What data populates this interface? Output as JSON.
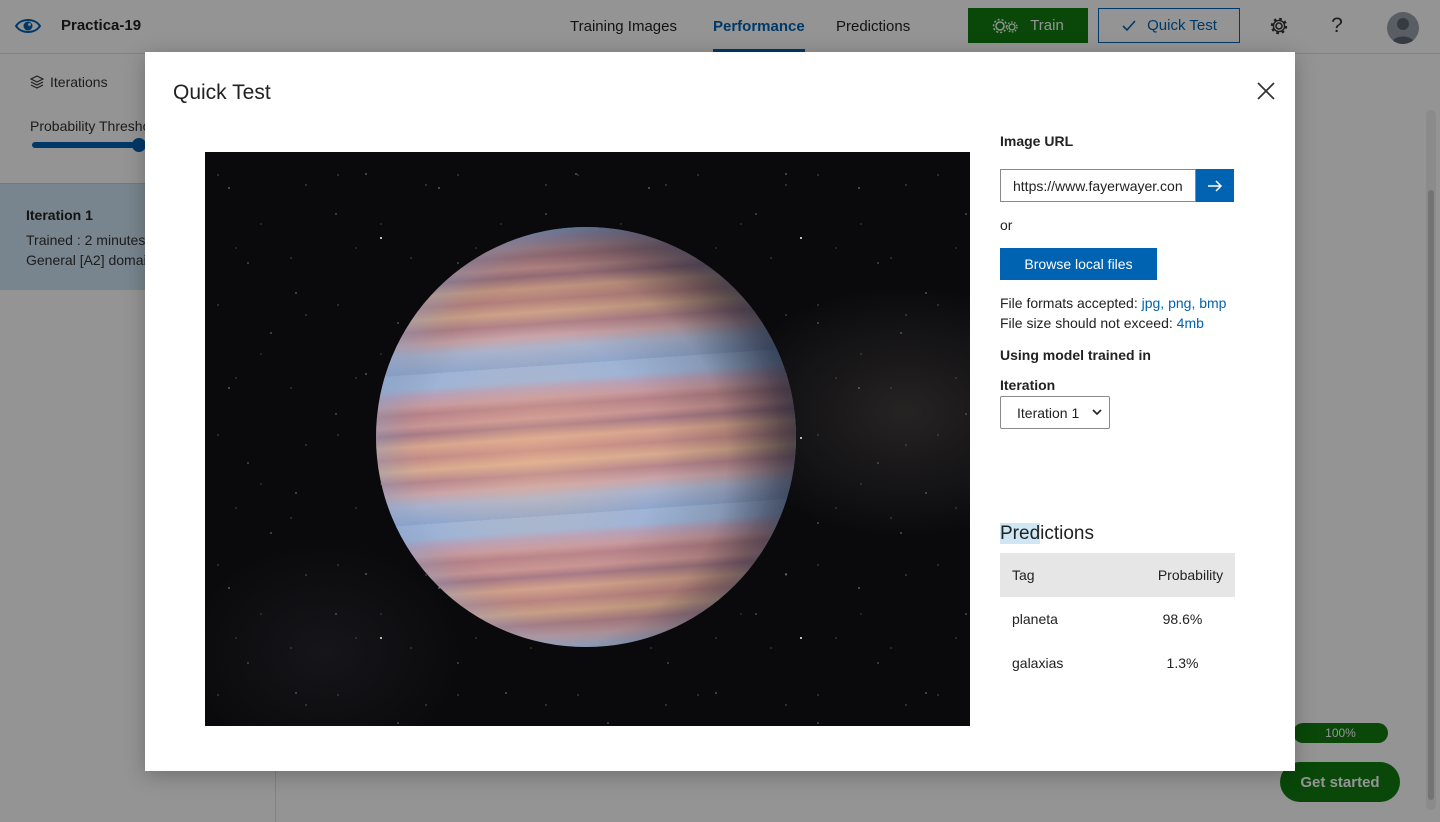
{
  "header": {
    "project_name": "Practica-19",
    "tabs": [
      {
        "label": "Training Images"
      },
      {
        "label": "Performance",
        "active": true
      },
      {
        "label": "Predictions"
      }
    ],
    "train_label": "Train",
    "quicktest_label": "Quick Test",
    "icons": [
      "eye-logo-icon",
      "gear-icon",
      "help-icon",
      "avatar"
    ]
  },
  "background_page": {
    "iterations_label": "Iterations",
    "probability_label": "Probability Thresho",
    "iteration_card": {
      "title": "Iteration 1",
      "trained": "Trained : 2 minutes",
      "domain": "General [A2] domai"
    },
    "progress": "100%",
    "get_started_label": "Get started"
  },
  "modal": {
    "title": "Quick Test",
    "image_url_label": "Image URL",
    "image_url_value": "https://www.fayerwayer.con",
    "or_label": "or",
    "browse_label": "Browse local files",
    "formats_label": "File formats accepted:",
    "formats": "jpg, png, bmp",
    "size_label": "File size should not exceed:",
    "size_value": "4mb",
    "model_label": "Using model trained in",
    "iteration_label": "Iteration",
    "iteration_selected": "Iteration 1",
    "predictions_title_highlight": "Pred",
    "predictions_title_rest": "ictions",
    "predictions": {
      "columns": [
        "Tag",
        "Probability"
      ],
      "rows": [
        {
          "tag": "planeta",
          "probability": "98.6%"
        },
        {
          "tag": "galaxias",
          "probability": "1.3%"
        }
      ]
    }
  },
  "colors": {
    "accent_blue": "#0063b1",
    "train_green": "#107c10",
    "selection_blue": "#cfe6f5"
  }
}
